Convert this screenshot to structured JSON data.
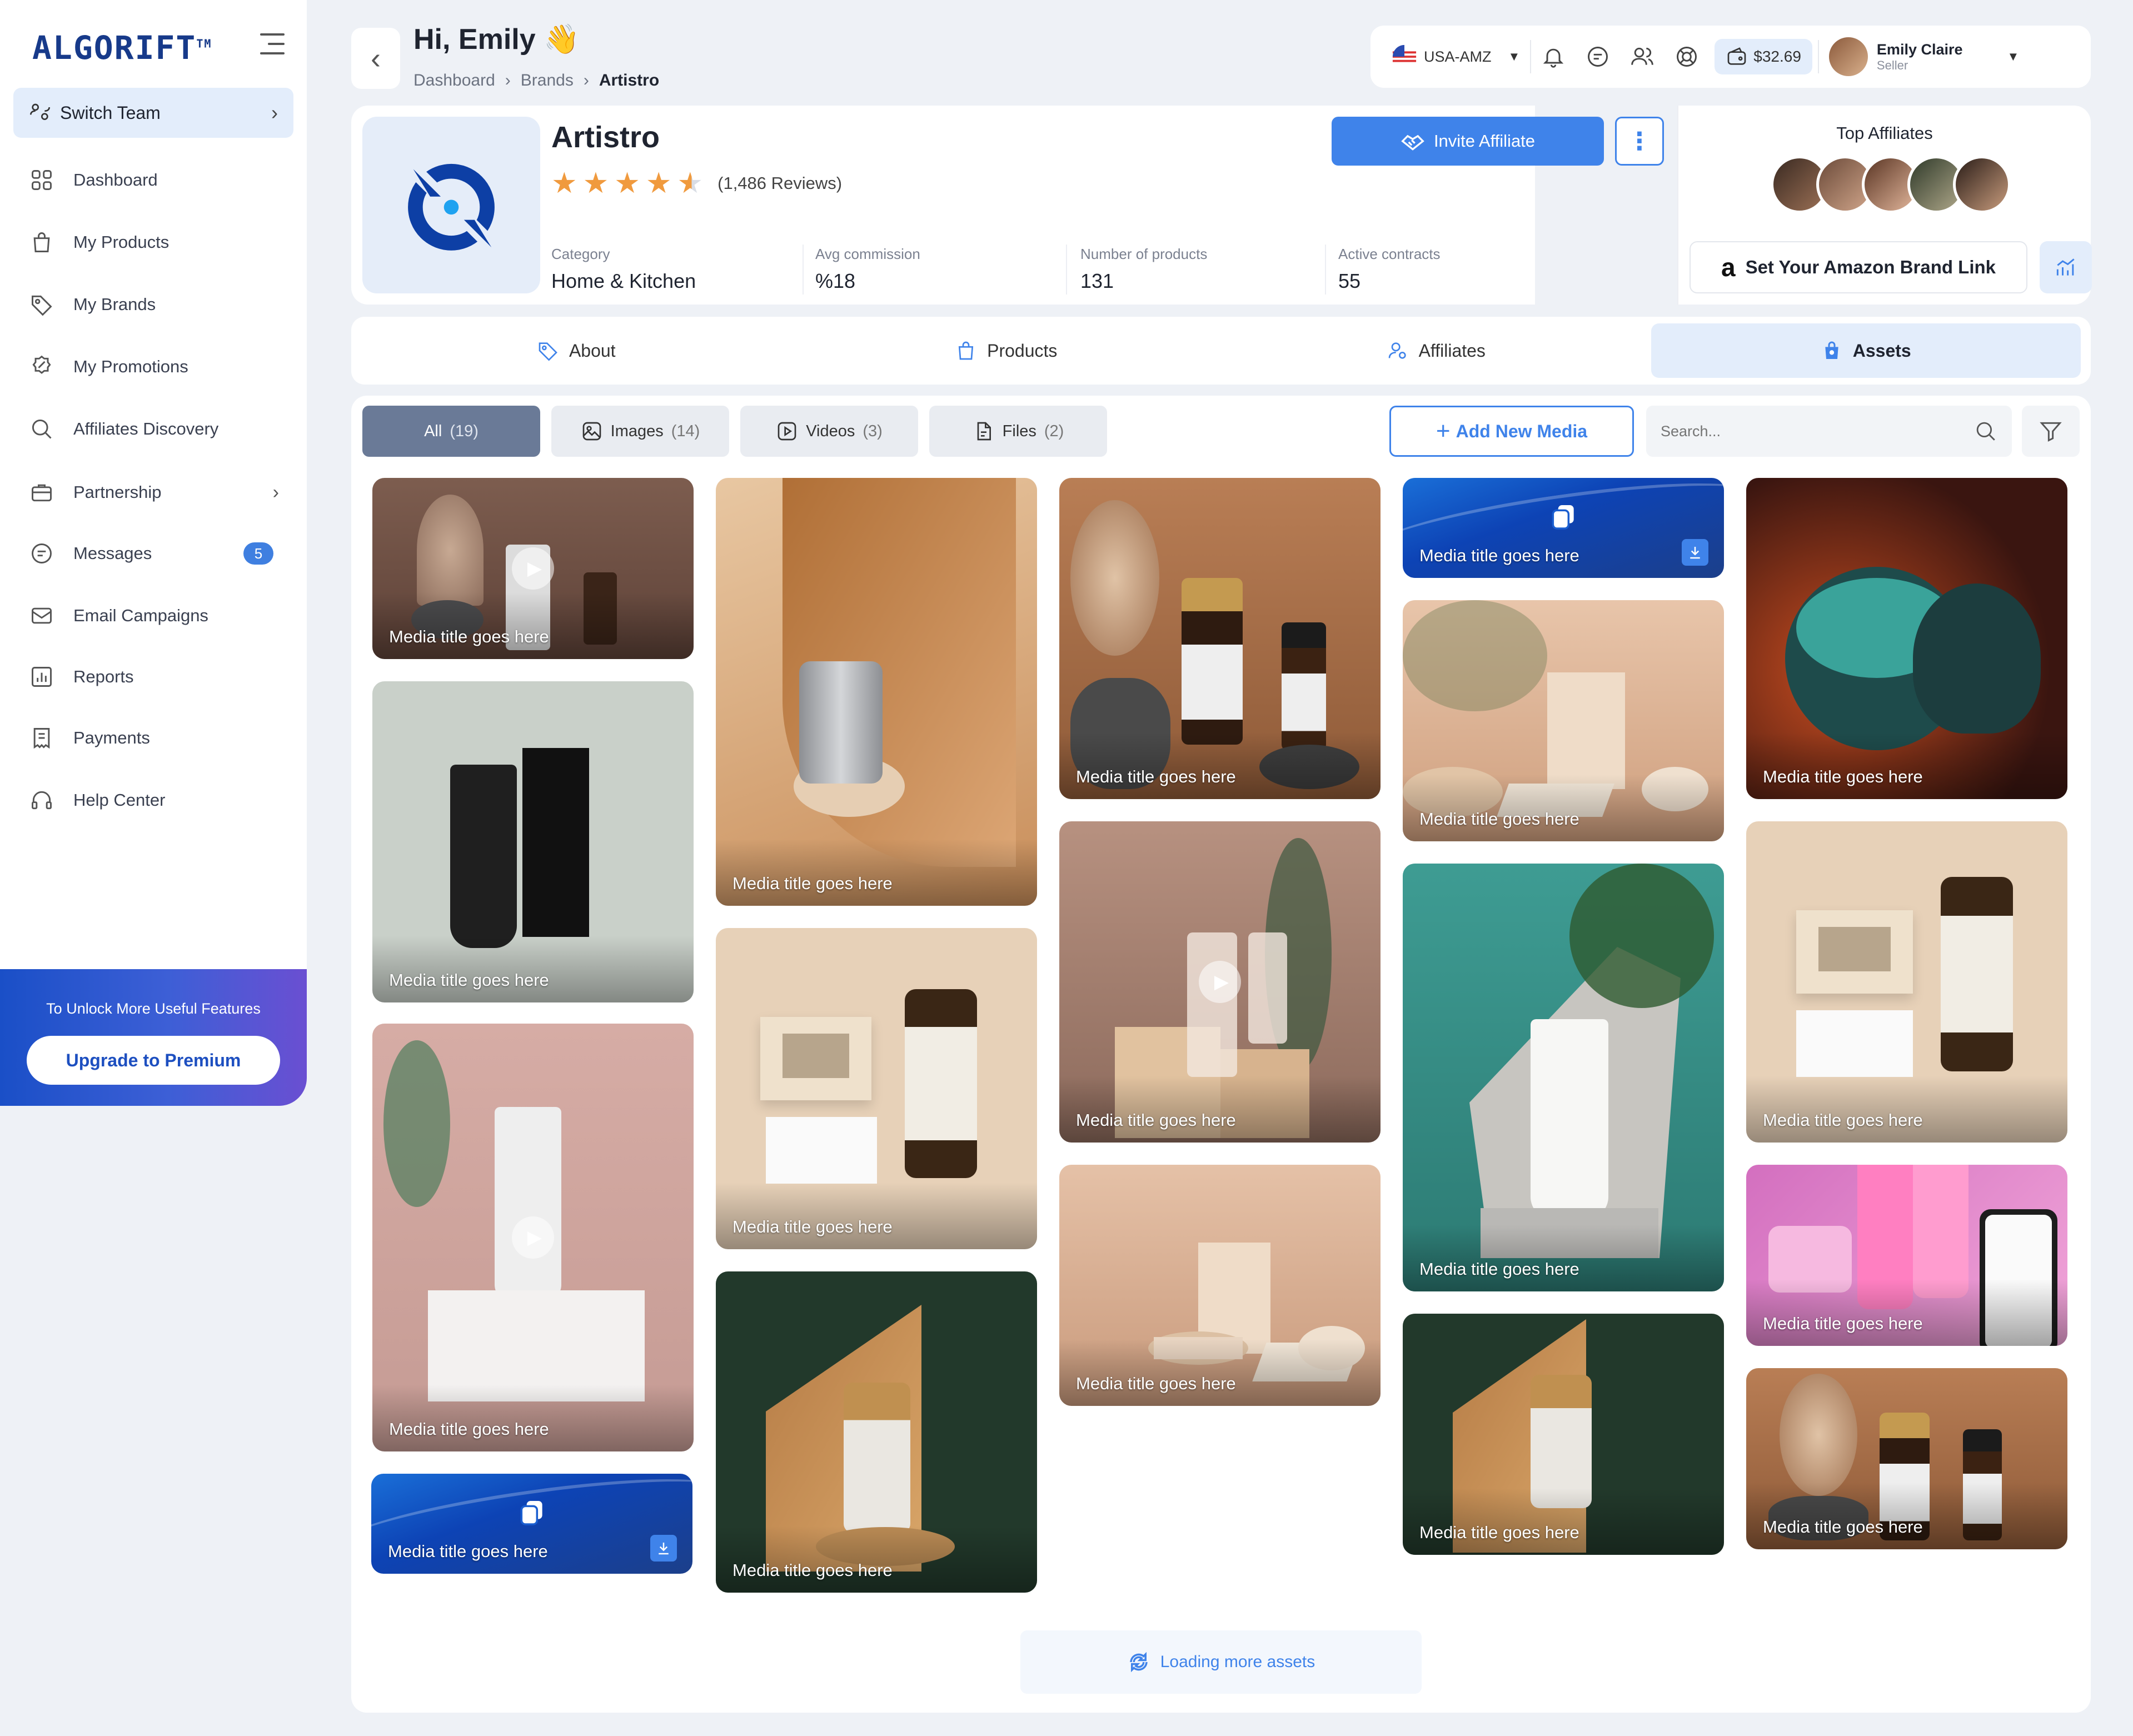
{
  "sidebar": {
    "logo": "ALGORIFT",
    "logo_tm": "TM",
    "switch_team": "Switch Team",
    "items": [
      {
        "label": "Dashboard"
      },
      {
        "label": "My Products"
      },
      {
        "label": "My Brands"
      },
      {
        "label": "My Promotions"
      },
      {
        "label": "Affiliates Discovery"
      },
      {
        "label": "Partnership"
      },
      {
        "label": "Messages",
        "badge": "5"
      },
      {
        "label": "Email Campaigns"
      },
      {
        "label": "Reports"
      },
      {
        "label": "Payments"
      },
      {
        "label": "Help Center"
      }
    ],
    "unlock_text": "To Unlock More Useful Features",
    "upgrade_label": "Upgrade to Premium"
  },
  "header": {
    "greeting": "Hi, Emily",
    "wave": "👋",
    "breadcrumb": [
      "Dashboard",
      "Brands",
      "Artistro"
    ],
    "marketplace": "USA-AMZ",
    "balance": "$32.69",
    "user_name": "Emily Claire",
    "user_role": "Seller"
  },
  "brand": {
    "name": "Artistro",
    "rating": 4.5,
    "reviews": "(1,486 Reviews)",
    "stats": [
      {
        "label": "Category",
        "value": "Home & Kitchen"
      },
      {
        "label": "Avg commission",
        "value": "%18"
      },
      {
        "label": "Number of products",
        "value": "131"
      },
      {
        "label": "Active contracts",
        "value": "55"
      }
    ],
    "invite_label": "Invite Affiliate",
    "top_affiliates_title": "Top Affiliates",
    "amazon_link_label": "Set Your Amazon Brand Link"
  },
  "tabs": [
    {
      "label": "About"
    },
    {
      "label": "Products"
    },
    {
      "label": "Affiliates"
    },
    {
      "label": "Assets",
      "active": true
    }
  ],
  "filters": [
    {
      "label": "All",
      "count": "(19)",
      "active": true
    },
    {
      "label": "Images",
      "count": "(14)"
    },
    {
      "label": "Videos",
      "count": "(3)"
    },
    {
      "label": "Files",
      "count": "(2)"
    }
  ],
  "add_media_label": "Add New Media",
  "search_placeholder": "Search...",
  "media_title": "Media title goes here",
  "loading_label": "Loading more assets",
  "colors": {
    "primary": "#3f83ea",
    "active_chip": "#6a7a97",
    "star": "#f09a3e",
    "brand_navy": "#173a8a"
  }
}
